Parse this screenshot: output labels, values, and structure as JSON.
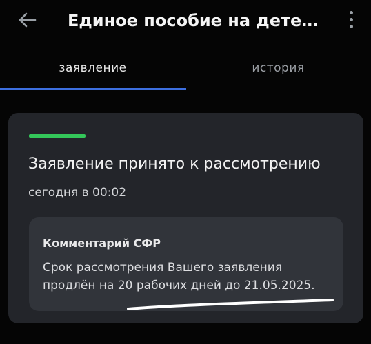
{
  "appbar": {
    "title": "Единое пособие на детей…",
    "back_icon": "arrow-left-icon",
    "menu_icon": "more-vertical-icon"
  },
  "tabs": [
    {
      "label": "заявление",
      "active": true
    },
    {
      "label": "история",
      "active": false
    }
  ],
  "colors": {
    "accent": "#3d6fe0",
    "status": "#34c75a",
    "card": "#23252a",
    "comment": "#31343a"
  },
  "status_card": {
    "title": "Заявление принято к рассмотрению",
    "date": "сегодня в 00:02",
    "comment": {
      "title": "Комментарий СФР",
      "line1": "Срок рассмотрения Вашего заявления",
      "line2": "продлён на 20 рабочих дней до 21.05.2025."
    }
  }
}
